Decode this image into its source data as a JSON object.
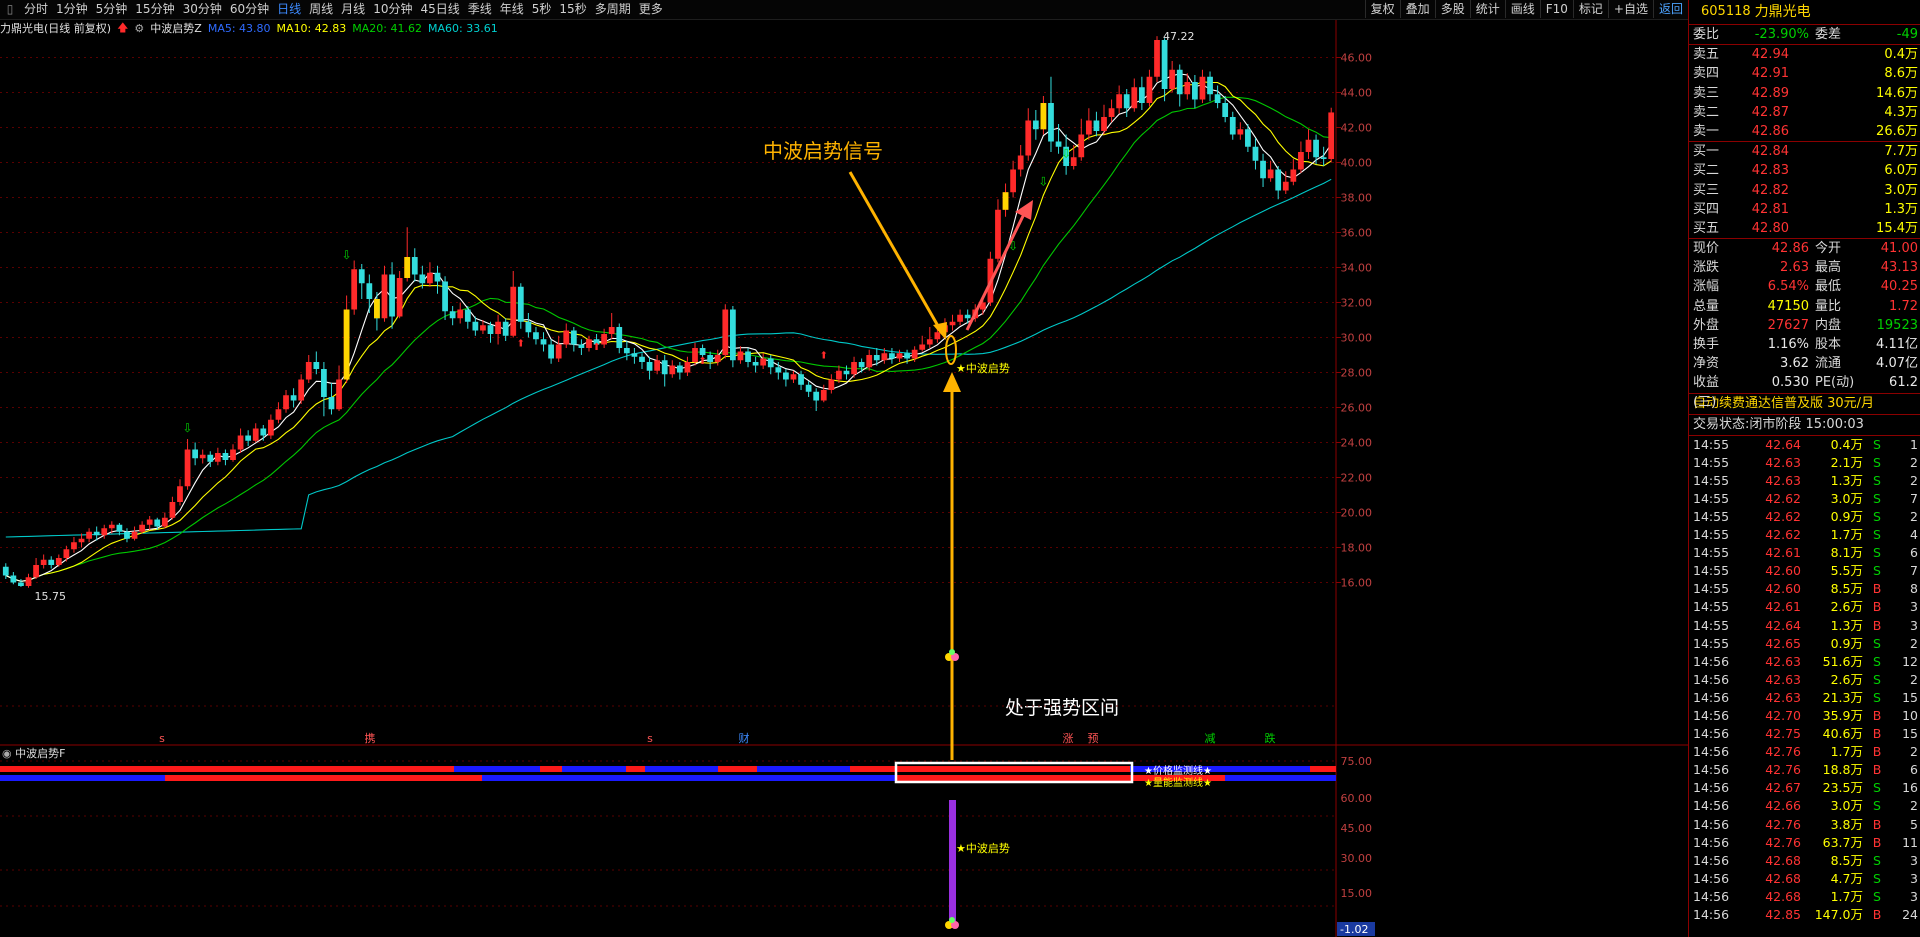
{
  "toolbar": {
    "periods": [
      "分时",
      "1分钟",
      "5分钟",
      "15分钟",
      "30分钟",
      "60分钟",
      "日线",
      "周线",
      "月线",
      "10分钟",
      "45日线",
      "季线",
      "年线",
      "5秒",
      "15秒",
      "多周期",
      "更多"
    ],
    "active_period": "日线",
    "buttons": [
      "复权",
      "叠加",
      "多股",
      "统计",
      "画线",
      "F10",
      "标记",
      "+自选",
      "返回"
    ]
  },
  "legend": {
    "stock": "力鼎光电(日线 前复权)",
    "indicator": "中波启势Z",
    "ma5": "MA5: 43.80",
    "ma10": "MA10: 42.83",
    "ma20": "MA20: 41.62",
    "ma60": "MA60: 33.61"
  },
  "colors": {
    "up": "#ff2a2a",
    "down": "#33dddd",
    "ma5": "#ffffff",
    "ma10": "#ffff00",
    "ma20": "#00c800",
    "ma60": "#00c8c8",
    "annot": "#ffb300"
  },
  "chart_data": {
    "type": "candlestick",
    "y_axis_ticks": [
      "46.00",
      "44.00",
      "42.00",
      "40.00",
      "38.00",
      "36.00",
      "34.00",
      "32.00",
      "30.00",
      "28.00",
      "26.00",
      "24.00",
      "22.00",
      "20.00",
      "18.00",
      "16.00"
    ],
    "y_range": [
      15,
      47
    ],
    "high_label": "47.22",
    "low_label": "15.75",
    "sub_axis_ticks": [
      "75.00",
      "60.00",
      "45.00",
      "30.00",
      "15.00"
    ],
    "sub_current": "-1.02",
    "event_markers": [
      "s",
      "携",
      "s",
      "财",
      "涨",
      "预",
      "减",
      "跌"
    ],
    "candles": [
      [
        16.9,
        16.4,
        16.2,
        17.1
      ],
      [
        16.4,
        16.0,
        15.9,
        16.6
      ],
      [
        16.0,
        15.8,
        15.75,
        16.2
      ],
      [
        15.8,
        16.3,
        15.7,
        16.5
      ],
      [
        16.3,
        17.0,
        16.2,
        17.4
      ],
      [
        17.0,
        17.3,
        16.8,
        17.6
      ],
      [
        17.3,
        17.0,
        16.8,
        17.5
      ],
      [
        17.0,
        17.4,
        16.9,
        17.6
      ],
      [
        17.4,
        17.9,
        17.2,
        18.1
      ],
      [
        17.9,
        18.3,
        17.7,
        18.6
      ],
      [
        18.3,
        18.5,
        18.0,
        18.8
      ],
      [
        18.5,
        18.9,
        18.3,
        19.1
      ],
      [
        18.9,
        18.7,
        18.4,
        19.2
      ],
      [
        18.7,
        19.1,
        18.5,
        19.3
      ],
      [
        19.1,
        19.3,
        18.8,
        19.5
      ],
      [
        19.3,
        18.9,
        18.7,
        19.4
      ],
      [
        18.9,
        18.5,
        18.3,
        19.1
      ],
      [
        18.5,
        18.9,
        18.4,
        19.2
      ],
      [
        18.9,
        19.3,
        18.8,
        19.5
      ],
      [
        19.3,
        19.6,
        19.0,
        19.8
      ],
      [
        19.6,
        19.2,
        19.0,
        19.7
      ],
      [
        19.2,
        19.7,
        19.1,
        20.0
      ],
      [
        19.7,
        20.6,
        19.6,
        20.9
      ],
      [
        20.6,
        21.5,
        20.4,
        21.9
      ],
      [
        21.5,
        23.6,
        21.3,
        24.2
      ],
      [
        23.6,
        23.1,
        22.7,
        24.0
      ],
      [
        23.1,
        23.3,
        22.8,
        23.6
      ],
      [
        23.3,
        22.9,
        22.6,
        23.5
      ],
      [
        22.9,
        23.4,
        22.7,
        23.7
      ],
      [
        23.4,
        23.0,
        22.7,
        23.6
      ],
      [
        23.0,
        23.6,
        22.9,
        23.9
      ],
      [
        23.6,
        24.4,
        23.4,
        24.8
      ],
      [
        24.4,
        24.1,
        23.8,
        24.7
      ],
      [
        24.1,
        24.8,
        24.0,
        25.1
      ],
      [
        24.8,
        24.4,
        24.1,
        25.0
      ],
      [
        24.4,
        25.3,
        24.2,
        25.6
      ],
      [
        25.3,
        25.9,
        25.1,
        26.3
      ],
      [
        25.9,
        26.7,
        25.7,
        27.0
      ],
      [
        26.7,
        26.4,
        26.0,
        27.1
      ],
      [
        26.4,
        27.6,
        26.2,
        27.9
      ],
      [
        27.6,
        28.6,
        27.4,
        29.0
      ],
      [
        28.6,
        28.2,
        27.9,
        29.2
      ],
      [
        28.2,
        26.6,
        25.5,
        28.6
      ],
      [
        26.6,
        25.9,
        25.6,
        27.4
      ],
      [
        25.9,
        27.6,
        25.8,
        28.4
      ],
      [
        27.6,
        31.6,
        27.4,
        32.4
      ],
      [
        31.6,
        33.9,
        31.3,
        34.4
      ],
      [
        33.9,
        33.1,
        32.2,
        34.2
      ],
      [
        33.1,
        32.2,
        31.4,
        33.6
      ],
      [
        32.2,
        31.1,
        30.4,
        32.6
      ],
      [
        31.1,
        33.6,
        30.9,
        34.1
      ],
      [
        33.6,
        31.2,
        30.5,
        34.3
      ],
      [
        31.2,
        33.4,
        31.1,
        33.8
      ],
      [
        33.4,
        34.6,
        33.2,
        36.3
      ],
      [
        34.6,
        33.6,
        33.2,
        35.1
      ],
      [
        33.6,
        33.1,
        32.8,
        34.1
      ],
      [
        33.1,
        33.7,
        32.9,
        34.3
      ],
      [
        33.7,
        33.2,
        32.5,
        34.1
      ],
      [
        33.2,
        31.5,
        31.0,
        33.5
      ],
      [
        31.5,
        31.1,
        30.7,
        31.8
      ],
      [
        31.1,
        31.6,
        30.8,
        32.0
      ],
      [
        31.6,
        30.9,
        30.5,
        31.8
      ],
      [
        30.9,
        30.4,
        30.1,
        31.2
      ],
      [
        30.4,
        30.7,
        30.2,
        31.0
      ],
      [
        30.7,
        30.2,
        29.7,
        30.9
      ],
      [
        30.2,
        30.9,
        29.6,
        31.3
      ],
      [
        30.9,
        30.1,
        29.8,
        31.1
      ],
      [
        30.1,
        32.9,
        30.0,
        33.8
      ],
      [
        32.9,
        30.9,
        30.5,
        33.1
      ],
      [
        30.9,
        30.3,
        30.0,
        31.4
      ],
      [
        30.3,
        29.9,
        29.6,
        30.6
      ],
      [
        29.9,
        29.6,
        29.2,
        30.3
      ],
      [
        29.6,
        28.8,
        28.5,
        29.9
      ],
      [
        28.8,
        29.6,
        28.6,
        30.1
      ],
      [
        29.6,
        30.4,
        29.4,
        30.8
      ],
      [
        30.4,
        29.6,
        29.2,
        30.6
      ],
      [
        29.6,
        29.4,
        29.0,
        29.9
      ],
      [
        29.4,
        29.9,
        29.2,
        30.1
      ],
      [
        29.9,
        29.6,
        29.3,
        30.2
      ],
      [
        29.6,
        30.2,
        29.4,
        30.5
      ],
      [
        30.2,
        30.6,
        29.9,
        31.4
      ],
      [
        30.6,
        29.4,
        29.1,
        30.8
      ],
      [
        29.4,
        29.1,
        28.7,
        29.8
      ],
      [
        29.1,
        28.9,
        28.5,
        29.4
      ],
      [
        28.9,
        28.6,
        28.2,
        29.1
      ],
      [
        28.6,
        28.1,
        27.6,
        28.9
      ],
      [
        28.1,
        28.7,
        27.9,
        29.0
      ],
      [
        28.7,
        27.9,
        27.2,
        29.0
      ],
      [
        27.9,
        28.4,
        27.7,
        28.7
      ],
      [
        28.4,
        28.0,
        27.6,
        28.6
      ],
      [
        28.0,
        28.6,
        27.8,
        28.9
      ],
      [
        28.6,
        29.4,
        28.4,
        29.7
      ],
      [
        29.4,
        29.0,
        28.6,
        29.6
      ],
      [
        29.0,
        28.6,
        28.2,
        29.2
      ],
      [
        28.6,
        29.0,
        28.4,
        29.3
      ],
      [
        29.0,
        31.6,
        28.8,
        31.9
      ],
      [
        31.6,
        28.7,
        28.3,
        31.8
      ],
      [
        28.7,
        29.2,
        28.5,
        29.5
      ],
      [
        29.2,
        28.6,
        28.3,
        29.4
      ],
      [
        28.6,
        28.4,
        28.0,
        28.9
      ],
      [
        28.4,
        28.8,
        28.2,
        29.1
      ],
      [
        28.8,
        28.3,
        27.9,
        29.0
      ],
      [
        28.3,
        28.0,
        27.6,
        28.6
      ],
      [
        28.0,
        27.6,
        27.2,
        28.2
      ],
      [
        27.6,
        27.9,
        27.4,
        28.1
      ],
      [
        27.9,
        27.3,
        27.0,
        28.1
      ],
      [
        27.3,
        26.9,
        26.6,
        27.5
      ],
      [
        26.9,
        26.4,
        25.8,
        27.1
      ],
      [
        26.4,
        27.0,
        26.3,
        27.3
      ],
      [
        27.0,
        27.6,
        26.8,
        27.9
      ],
      [
        27.6,
        28.1,
        27.4,
        28.4
      ],
      [
        28.1,
        27.9,
        27.6,
        28.4
      ],
      [
        27.9,
        28.6,
        27.7,
        28.9
      ],
      [
        28.6,
        28.3,
        28.0,
        28.8
      ],
      [
        28.3,
        29.0,
        28.1,
        29.3
      ],
      [
        29.0,
        28.7,
        28.4,
        29.4
      ],
      [
        28.7,
        29.1,
        28.5,
        29.4
      ],
      [
        29.1,
        28.8,
        28.5,
        29.4
      ],
      [
        28.8,
        29.1,
        28.6,
        29.3
      ],
      [
        29.1,
        28.8,
        28.5,
        29.3
      ],
      [
        28.8,
        29.3,
        28.6,
        29.5
      ],
      [
        29.3,
        29.6,
        29.2,
        30.1
      ],
      [
        29.6,
        29.9,
        29.4,
        30.6
      ],
      [
        29.9,
        30.3,
        29.7,
        30.6
      ],
      [
        30.3,
        30.7,
        30.1,
        31.1
      ],
      [
        30.7,
        30.9,
        30.4,
        31.3
      ],
      [
        30.9,
        31.3,
        30.7,
        31.6
      ],
      [
        31.3,
        31.1,
        30.8,
        31.6
      ],
      [
        31.1,
        31.6,
        30.9,
        31.9
      ],
      [
        31.6,
        32.0,
        31.3,
        32.3
      ],
      [
        32.0,
        34.5,
        31.8,
        34.9
      ],
      [
        34.5,
        37.3,
        34.3,
        37.9
      ],
      [
        37.3,
        38.3,
        36.9,
        38.8
      ],
      [
        38.3,
        39.6,
        38.0,
        40.1
      ],
      [
        39.6,
        40.4,
        39.2,
        41.0
      ],
      [
        40.4,
        42.4,
        40.1,
        43.1
      ],
      [
        42.4,
        41.9,
        41.3,
        43.0
      ],
      [
        41.9,
        43.4,
        41.6,
        43.8
      ],
      [
        43.4,
        41.2,
        40.6,
        44.9
      ],
      [
        41.2,
        40.9,
        40.5,
        42.2
      ],
      [
        40.9,
        39.8,
        39.3,
        41.6
      ],
      [
        39.8,
        40.3,
        39.6,
        41.0
      ],
      [
        40.3,
        41.6,
        40.1,
        42.5
      ],
      [
        41.6,
        42.4,
        41.3,
        43.1
      ],
      [
        42.4,
        41.8,
        41.5,
        42.9
      ],
      [
        41.8,
        42.6,
        41.6,
        43.3
      ],
      [
        42.6,
        43.1,
        42.3,
        43.6
      ],
      [
        43.1,
        43.9,
        42.8,
        44.4
      ],
      [
        43.9,
        43.1,
        42.6,
        44.2
      ],
      [
        43.1,
        44.3,
        42.9,
        44.8
      ],
      [
        44.3,
        43.4,
        43.0,
        44.9
      ],
      [
        43.4,
        44.9,
        43.2,
        45.3
      ],
      [
        44.9,
        47.0,
        44.6,
        47.22
      ],
      [
        47.0,
        44.2,
        43.5,
        47.1
      ],
      [
        44.2,
        45.3,
        44.0,
        45.8
      ],
      [
        45.3,
        43.9,
        43.2,
        45.6
      ],
      [
        43.9,
        44.6,
        43.6,
        45.1
      ],
      [
        44.6,
        43.6,
        43.1,
        45.0
      ],
      [
        43.6,
        44.9,
        43.4,
        45.3
      ],
      [
        44.9,
        43.9,
        43.5,
        45.2
      ],
      [
        43.9,
        43.4,
        43.1,
        44.4
      ],
      [
        43.4,
        42.6,
        42.3,
        43.8
      ],
      [
        42.6,
        41.6,
        41.3,
        42.9
      ],
      [
        41.6,
        41.9,
        41.3,
        42.3
      ],
      [
        41.9,
        40.9,
        40.6,
        42.2
      ],
      [
        40.9,
        40.1,
        39.6,
        41.4
      ],
      [
        40.1,
        39.1,
        38.6,
        40.5
      ],
      [
        39.1,
        39.6,
        38.9,
        40.1
      ],
      [
        39.6,
        38.4,
        37.9,
        39.8
      ],
      [
        38.4,
        38.9,
        38.2,
        39.5
      ],
      [
        38.9,
        39.6,
        38.7,
        40.2
      ],
      [
        39.6,
        40.6,
        39.4,
        41.2
      ],
      [
        40.6,
        41.3,
        40.2,
        41.9
      ],
      [
        41.3,
        40.3,
        39.9,
        41.6
      ],
      [
        40.3,
        40.2,
        39.8,
        40.9
      ],
      [
        40.2,
        42.86,
        40.0,
        43.13
      ]
    ],
    "ma5_last": 43.8,
    "ma10_last": 42.83,
    "ma20_last": 41.62,
    "ma60_last": 33.61
  },
  "annotations": {
    "signal_title": "中波启势信号",
    "signal_marker": "★中波启势",
    "zone_text": "处于强势区间",
    "sub_marker": "★中波启势",
    "price_line": "★价格监测线★",
    "volume_line": "★量能监测线★"
  },
  "sub_legend": "中波启势F",
  "quote": {
    "code": "605118",
    "name": "力鼎光电",
    "weibi_label": "委比",
    "weibi": "-23.90%",
    "weicha_label": "委差",
    "weicha": "-49",
    "asks": [
      {
        "label": "卖五",
        "price": "42.94",
        "vol": "0.4万"
      },
      {
        "label": "卖四",
        "price": "42.91",
        "vol": "8.6万"
      },
      {
        "label": "卖三",
        "price": "42.89",
        "vol": "14.6万"
      },
      {
        "label": "卖二",
        "price": "42.87",
        "vol": "4.3万"
      },
      {
        "label": "卖一",
        "price": "42.86",
        "vol": "26.6万"
      }
    ],
    "bids": [
      {
        "label": "买一",
        "price": "42.84",
        "vol": "7.7万"
      },
      {
        "label": "买二",
        "price": "42.83",
        "vol": "6.0万"
      },
      {
        "label": "买三",
        "price": "42.82",
        "vol": "3.0万"
      },
      {
        "label": "买四",
        "price": "42.81",
        "vol": "1.3万"
      },
      {
        "label": "买五",
        "price": "42.80",
        "vol": "15.4万"
      }
    ],
    "stats": [
      {
        "l1": "现价",
        "v1": "42.86",
        "c1": "red",
        "l2": "今开",
        "v2": "41.00",
        "c2": "red"
      },
      {
        "l1": "涨跌",
        "v1": "2.63",
        "c1": "red",
        "l2": "最高",
        "v2": "43.13",
        "c2": "red"
      },
      {
        "l1": "涨幅",
        "v1": "6.54%",
        "c1": "red",
        "l2": "最低",
        "v2": "40.25",
        "c2": "red"
      },
      {
        "l1": "总量",
        "v1": "47150",
        "c1": "yellow",
        "l2": "量比",
        "v2": "1.72",
        "c2": "red"
      },
      {
        "l1": "外盘",
        "v1": "27627",
        "c1": "red",
        "l2": "内盘",
        "v2": "19523",
        "c2": "green"
      },
      {
        "l1": "换手",
        "v1": "1.16%",
        "c1": "white",
        "l2": "股本",
        "v2": "4.11亿",
        "c2": "white"
      },
      {
        "l1": "净资",
        "v1": "3.62",
        "c1": "white",
        "l2": "流通",
        "v2": "4.07亿",
        "c2": "white"
      },
      {
        "l1": "收益(三)",
        "v1": "0.530",
        "c1": "white",
        "l2": "PE(动)",
        "v2": "61.2",
        "c2": "white"
      }
    ],
    "ad_text": "自动续费通达信普及版 30元/月",
    "status_text": "交易状态:闭市阶段 15:00:03",
    "ticks": [
      [
        "14:55",
        "42.64",
        "0.4万",
        "S",
        "1"
      ],
      [
        "14:55",
        "42.63",
        "2.1万",
        "S",
        "2"
      ],
      [
        "14:55",
        "42.63",
        "1.3万",
        "S",
        "2"
      ],
      [
        "14:55",
        "42.62",
        "3.0万",
        "S",
        "7"
      ],
      [
        "14:55",
        "42.62",
        "0.9万",
        "S",
        "2"
      ],
      [
        "14:55",
        "42.62",
        "1.7万",
        "S",
        "4"
      ],
      [
        "14:55",
        "42.61",
        "8.1万",
        "S",
        "6"
      ],
      [
        "14:55",
        "42.60",
        "5.5万",
        "S",
        "7"
      ],
      [
        "14:55",
        "42.60",
        "8.5万",
        "B",
        "8"
      ],
      [
        "14:55",
        "42.61",
        "2.6万",
        "B",
        "3"
      ],
      [
        "14:55",
        "42.64",
        "1.3万",
        "B",
        "3"
      ],
      [
        "14:55",
        "42.65",
        "0.9万",
        "S",
        "2"
      ],
      [
        "14:56",
        "42.63",
        "51.6万",
        "S",
        "12"
      ],
      [
        "14:56",
        "42.63",
        "2.6万",
        "S",
        "2"
      ],
      [
        "14:56",
        "42.63",
        "21.3万",
        "S",
        "15"
      ],
      [
        "14:56",
        "42.70",
        "35.9万",
        "B",
        "10"
      ],
      [
        "14:56",
        "42.75",
        "40.6万",
        "B",
        "15"
      ],
      [
        "14:56",
        "42.76",
        "1.7万",
        "B",
        "2"
      ],
      [
        "14:56",
        "42.76",
        "18.8万",
        "B",
        "6"
      ],
      [
        "14:56",
        "42.67",
        "23.5万",
        "S",
        "16"
      ],
      [
        "14:56",
        "42.66",
        "3.0万",
        "S",
        "2"
      ],
      [
        "14:56",
        "42.76",
        "3.8万",
        "B",
        "5"
      ],
      [
        "14:56",
        "42.76",
        "63.7万",
        "B",
        "11"
      ],
      [
        "14:56",
        "42.68",
        "8.5万",
        "S",
        "3"
      ],
      [
        "14:56",
        "42.68",
        "4.7万",
        "S",
        "3"
      ],
      [
        "14:56",
        "42.68",
        "1.7万",
        "S",
        "3"
      ],
      [
        "14:56",
        "42.85",
        "147.0万",
        "B",
        "24"
      ]
    ]
  }
}
